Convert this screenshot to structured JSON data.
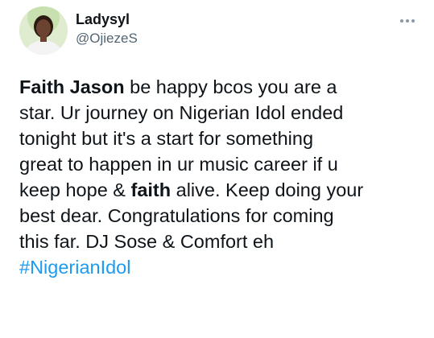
{
  "author": {
    "display_name": "Ladysyl",
    "handle": "@OjiezeS"
  },
  "more_icon": "more-horizontal-icon",
  "tweet": {
    "lines": [
      {
        "segments": [
          {
            "text": "Faith Jason",
            "bold": true
          },
          {
            "text": " be happy bcos you are a",
            "bold": false
          }
        ]
      },
      {
        "segments": [
          {
            "text": "star. Ur journey on Nigerian Idol ended",
            "bold": false
          }
        ]
      },
      {
        "segments": [
          {
            "text": "tonight but it's a start for something",
            "bold": false
          }
        ]
      },
      {
        "segments": [
          {
            "text": "great to happen in ur music career if u",
            "bold": false
          }
        ]
      },
      {
        "segments": [
          {
            "text": "keep hope & ",
            "bold": false
          },
          {
            "text": "faith",
            "bold": true
          },
          {
            "text": " alive. Keep doing your",
            "bold": false
          }
        ]
      },
      {
        "segments": [
          {
            "text": "best dear. Congratulations for coming",
            "bold": false
          }
        ]
      },
      {
        "segments": [
          {
            "text": "this far. DJ Sose & Comfort eh",
            "bold": false
          }
        ]
      }
    ],
    "hashtag": "#NigerianIdol"
  },
  "colors": {
    "text": "#0f1419",
    "secondary": "#536471",
    "link": "#1d9bf0"
  }
}
